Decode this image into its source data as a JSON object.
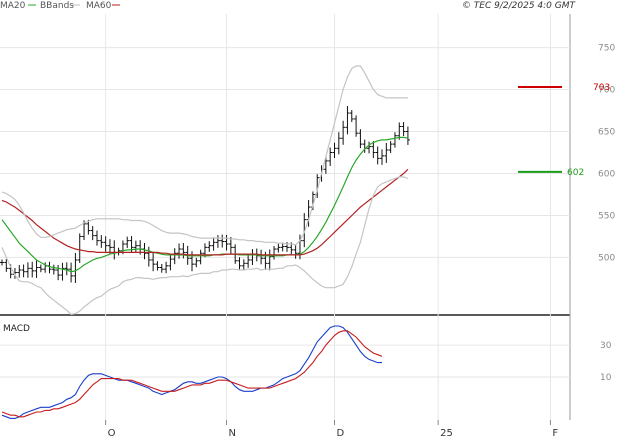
{
  "legend": [
    {
      "label": "MA20",
      "color": "#2aa82a"
    },
    {
      "label": "BBands",
      "color": "#bdbdbd"
    },
    {
      "label": "MA60",
      "color": "#b22222"
    }
  ],
  "header": {
    "copyright": "© TEC 9/2/2025 4:0 GMT"
  },
  "indicator_title": "MACD",
  "chart_data": {
    "type": "line",
    "price_panel": {
      "ylim": [
        435,
        790
      ],
      "y_ticks": [
        {
          "value": 750,
          "label": "750"
        },
        {
          "value": 700,
          "label": "700"
        },
        {
          "value": 650,
          "label": "650"
        },
        {
          "value": 600,
          "label": "600"
        },
        {
          "value": 550,
          "label": "550"
        },
        {
          "value": 500,
          "label": "500"
        }
      ],
      "close": [
        494,
        487,
        480,
        482,
        485,
        483,
        487,
        484,
        488,
        486,
        490,
        486,
        485,
        479,
        487,
        486,
        478,
        497,
        525,
        540,
        532,
        526,
        520,
        518,
        514,
        512,
        506,
        508,
        516,
        520,
        512,
        514,
        510,
        505,
        497,
        492,
        488,
        486,
        490,
        498,
        505,
        510,
        506,
        499,
        492,
        496,
        505,
        512,
        514,
        518,
        520,
        519,
        516,
        512,
        496,
        490,
        493,
        497,
        504,
        502,
        499,
        493,
        501,
        510,
        512,
        513,
        512,
        509,
        505,
        520,
        545,
        560,
        575,
        595,
        605,
        615,
        625,
        630,
        642,
        655,
        672,
        665,
        648,
        635,
        630,
        632,
        625,
        618,
        621,
        628,
        635,
        645,
        656,
        650,
        640
      ],
      "series": [
        {
          "name": "MA20",
          "values": [
            545,
            538,
            531,
            524,
            517,
            512,
            507,
            502,
            497,
            494,
            491,
            489,
            488,
            487,
            486,
            485,
            483,
            484,
            487,
            491,
            494,
            497,
            499,
            500,
            502,
            504,
            505,
            506,
            508,
            509,
            509,
            510,
            510,
            509,
            508,
            506,
            505,
            504,
            503,
            503,
            503,
            503,
            503,
            502,
            502,
            502,
            502,
            502,
            502,
            503,
            503,
            504,
            504,
            504,
            504,
            503,
            503,
            503,
            503,
            503,
            502,
            502,
            502,
            502,
            502,
            502,
            503,
            503,
            503,
            504,
            507,
            512,
            518,
            525,
            533,
            542,
            552,
            562,
            573,
            584,
            596,
            607,
            616,
            623,
            629,
            634,
            637,
            639,
            640,
            640,
            641,
            642,
            643,
            643,
            642
          ]
        },
        {
          "name": "MA60",
          "values": [
            568,
            566,
            563,
            560,
            556,
            552,
            548,
            544,
            539,
            535,
            531,
            527,
            523,
            520,
            517,
            514,
            512,
            510,
            509,
            508,
            507,
            507,
            506,
            506,
            506,
            506,
            506,
            506,
            506,
            506,
            506,
            506,
            506,
            506,
            506,
            506,
            506,
            505,
            505,
            504,
            504,
            504,
            504,
            503,
            503,
            503,
            503,
            503,
            503,
            503,
            503,
            503,
            504,
            504,
            504,
            504,
            504,
            504,
            504,
            504,
            503,
            503,
            503,
            503,
            503,
            503,
            503,
            503,
            503,
            503,
            504,
            506,
            508,
            511,
            515,
            520,
            525,
            530,
            535,
            540,
            545,
            550,
            555,
            560,
            564,
            568,
            572,
            576,
            580,
            584,
            588,
            592,
            596,
            600,
            605
          ]
        },
        {
          "name": "BB_upper",
          "values": [
            578,
            576,
            573,
            569,
            562,
            553,
            543,
            535,
            528,
            524,
            524,
            525,
            527,
            529,
            531,
            533,
            534,
            535,
            538,
            541,
            543,
            545,
            546,
            546,
            546,
            546,
            546,
            546,
            545,
            545,
            544,
            544,
            544,
            543,
            541,
            538,
            535,
            532,
            530,
            529,
            529,
            529,
            528,
            527,
            525,
            524,
            523,
            523,
            523,
            523,
            523,
            523,
            523,
            522,
            522,
            521,
            521,
            520,
            520,
            519,
            519,
            518,
            518,
            518,
            517,
            517,
            516,
            516,
            515,
            520,
            530,
            545,
            562,
            580,
            600,
            620,
            640,
            660,
            680,
            700,
            715,
            725,
            728,
            728,
            720,
            710,
            700,
            694,
            692,
            690,
            690,
            690,
            690,
            690,
            690
          ]
        },
        {
          "name": "BB_lower",
          "values": [
            512,
            500,
            489,
            479,
            472,
            471,
            471,
            469,
            466,
            464,
            458,
            453,
            449,
            445,
            441,
            437,
            432,
            433,
            436,
            441,
            445,
            449,
            452,
            454,
            458,
            462,
            464,
            466,
            471,
            473,
            474,
            476,
            476,
            475,
            475,
            474,
            475,
            476,
            476,
            477,
            477,
            477,
            478,
            477,
            479,
            480,
            481,
            481,
            481,
            483,
            483,
            485,
            485,
            486,
            486,
            485,
            485,
            486,
            486,
            487,
            485,
            486,
            486,
            486,
            487,
            487,
            490,
            490,
            491,
            488,
            484,
            479,
            474,
            470,
            466,
            464,
            464,
            464,
            466,
            468,
            477,
            489,
            504,
            518,
            538,
            558,
            574,
            584,
            588,
            590,
            592,
            594,
            596,
            596,
            594
          ]
        }
      ],
      "resistance": {
        "value": 703,
        "label": "703",
        "color": "#cc0000"
      },
      "support": {
        "value": 602,
        "label": "602",
        "color": "#1a9c1a"
      }
    },
    "macd_panel": {
      "ylim": [
        -17,
        47
      ],
      "y_ticks": [
        {
          "value": 30,
          "label": "30"
        },
        {
          "value": 10,
          "label": "10"
        }
      ],
      "series": [
        {
          "name": "MACD",
          "values": [
            -14,
            -15,
            -16,
            -16,
            -15,
            -13,
            -12,
            -11,
            -10,
            -9,
            -9,
            -9,
            -8,
            -7,
            -6,
            -4,
            -3,
            -1,
            4,
            8,
            11,
            12,
            12,
            12,
            11,
            10,
            9,
            8,
            8,
            8,
            7,
            6,
            5,
            4,
            3,
            1,
            0,
            -1,
            0,
            1,
            2,
            4,
            6,
            7,
            7,
            6,
            6,
            7,
            8,
            9,
            10,
            10,
            9,
            7,
            4,
            2,
            1,
            1,
            1,
            2,
            3,
            3,
            4,
            5,
            7,
            9,
            10,
            11,
            12,
            14,
            18,
            22,
            27,
            32,
            35,
            38,
            41,
            42,
            42,
            41,
            38,
            34,
            30,
            26,
            23,
            21,
            20,
            19,
            19
          ]
        },
        {
          "name": "Signal",
          "values": [
            -12,
            -13,
            -14,
            -14,
            -15,
            -15,
            -14,
            -13,
            -12,
            -12,
            -11,
            -11,
            -10,
            -10,
            -9,
            -8,
            -7,
            -6,
            -4,
            -1,
            2,
            5,
            7,
            9,
            9,
            9,
            9,
            9,
            8,
            8,
            8,
            7,
            6,
            5,
            4,
            3,
            2,
            1,
            1,
            1,
            1,
            2,
            3,
            4,
            5,
            5,
            5,
            6,
            6,
            7,
            8,
            8,
            8,
            7,
            6,
            5,
            4,
            3,
            3,
            3,
            3,
            3,
            3,
            4,
            5,
            6,
            7,
            8,
            9,
            11,
            13,
            16,
            19,
            23,
            26,
            30,
            33,
            36,
            38,
            39,
            39,
            37,
            35,
            32,
            29,
            27,
            25,
            24,
            23
          ]
        }
      ]
    },
    "x_ticks": [
      {
        "index": 24,
        "label": "O"
      },
      {
        "index": 52,
        "label": "N"
      },
      {
        "index": 77,
        "label": "D"
      },
      {
        "index": 101,
        "label": "25"
      },
      {
        "index": 127,
        "label": "F"
      }
    ],
    "total_bars": 132
  }
}
